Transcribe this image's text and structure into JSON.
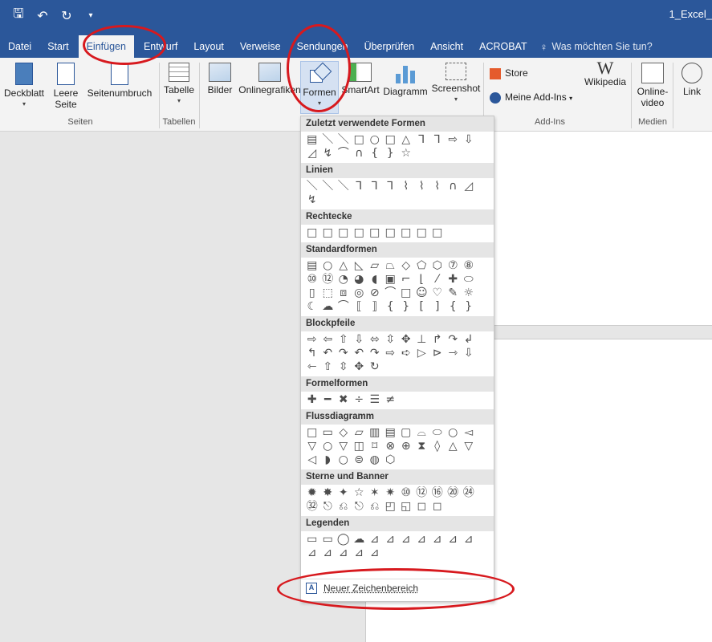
{
  "titlebar": {
    "qat": [
      "save-icon",
      "undo-icon",
      "redo-icon",
      "customize-icon"
    ],
    "title": "1_Excel_"
  },
  "tabs": [
    "Datei",
    "Start",
    "Einfügen",
    "Entwurf",
    "Layout",
    "Verweise",
    "Sendungen",
    "Überprüfen",
    "Ansicht",
    "ACROBAT"
  ],
  "active_tab": "Einfügen",
  "tellme_placeholder": "Was möchten Sie tun?",
  "ribbon": {
    "deckblatt": "Deckblatt",
    "leere_seite_1": "Leere",
    "leere_seite_2": "Seite",
    "seitenumbruch": "Seitenumbruch",
    "tabelle": "Tabelle",
    "bilder": "Bilder",
    "onlinegrafiken": "Onlinegrafiken",
    "formen": "Formen",
    "smartart": "SmartArt",
    "diagramm": "Diagramm",
    "screenshot": "Screenshot",
    "store": "Store",
    "meine_addins": "Meine Add-Ins",
    "wikipedia": "Wikipedia",
    "onlinevideo_1": "Online-",
    "onlinevideo_2": "video",
    "link": "Link",
    "groups": {
      "seiten": "Seiten",
      "tabellen": "Tabellen",
      "addins": "Add-Ins",
      "medien": "Medien"
    }
  },
  "dropdown": {
    "sections": [
      {
        "title": "Zuletzt verwendete Formen",
        "shapes": [
          "▤",
          "＼",
          "＼",
          "□",
          "○",
          "□",
          "△",
          "⅂",
          "⅂",
          "⇨",
          "⇩",
          "◿",
          "↯",
          "⌒",
          "∩",
          "{",
          "}",
          "☆"
        ]
      },
      {
        "title": "Linien",
        "shapes": [
          "＼",
          "＼",
          "＼",
          "⅂",
          "⅂",
          "⅂",
          "⌇",
          "⌇",
          "⌇",
          "∩",
          "◿",
          "↯"
        ]
      },
      {
        "title": "Rechtecke",
        "shapes": [
          "□",
          "□",
          "□",
          "□",
          "□",
          "□",
          "□",
          "□",
          "□"
        ]
      },
      {
        "title": "Standardformen",
        "shapes": [
          "▤",
          "○",
          "△",
          "◺",
          "▱",
          "⏢",
          "◇",
          "⬠",
          "⬡",
          "⑦",
          "⑧",
          "⑩",
          "⑫",
          "◔",
          "◕",
          "◖",
          "▣",
          "⌐",
          "⌊",
          "⁄",
          "✚",
          "⬭",
          "▯",
          "⬚",
          "⧈",
          "◎",
          "⊘",
          "⌒",
          "□",
          "☺",
          "♡",
          "✎",
          "☼",
          "☾",
          "☁",
          "⌒",
          "⟦",
          "⟧",
          "{",
          "}",
          "[",
          "]",
          "{",
          "}"
        ]
      },
      {
        "title": "Blockpfeile",
        "shapes": [
          "⇨",
          "⇦",
          "⇧",
          "⇩",
          "⬄",
          "⇳",
          "✥",
          "⊥",
          "↱",
          "↷",
          "↲",
          "↰",
          "↶",
          "↷",
          "↶",
          "↷",
          "⇨",
          "➪",
          "▷",
          "⊳",
          "⇾",
          "⇩",
          "⇽",
          "⇧",
          "⇳",
          "✥",
          "↻"
        ]
      },
      {
        "title": "Formelformen",
        "shapes": [
          "✚",
          "━",
          "✖",
          "÷",
          "☰",
          "≠"
        ]
      },
      {
        "title": "Flussdiagramm",
        "shapes": [
          "□",
          "▭",
          "◇",
          "▱",
          "▥",
          "▤",
          "▢",
          "⌓",
          "⬭",
          "○",
          "◅",
          "▽",
          "○",
          "▽",
          "◫",
          "⌑",
          "⊗",
          "⊕",
          "⧗",
          "◊",
          "△",
          "▽",
          "◁",
          "◗",
          "○",
          "⊜",
          "◍",
          "⬡"
        ]
      },
      {
        "title": "Sterne und Banner",
        "shapes": [
          "✹",
          "✸",
          "✦",
          "☆",
          "✶",
          "✷",
          "⑩",
          "⑫",
          "⑯",
          "⑳",
          "㉔",
          "㉜",
          "⎋",
          "⎌",
          "⎋",
          "⎌",
          "◰",
          "◱",
          "◻",
          "◻"
        ]
      },
      {
        "title": "Legenden",
        "shapes": [
          "▭",
          "▭",
          "◯",
          "☁",
          "⊿",
          "⊿",
          "⊿",
          "⊿",
          "⊿",
          "⊿",
          "⊿",
          "⊿",
          "⊿",
          "⊿",
          "⊿",
          "⊿"
        ]
      }
    ],
    "new_canvas_label": "Neuer Zeichenbereich"
  },
  "annotation_color": "#d7191e"
}
